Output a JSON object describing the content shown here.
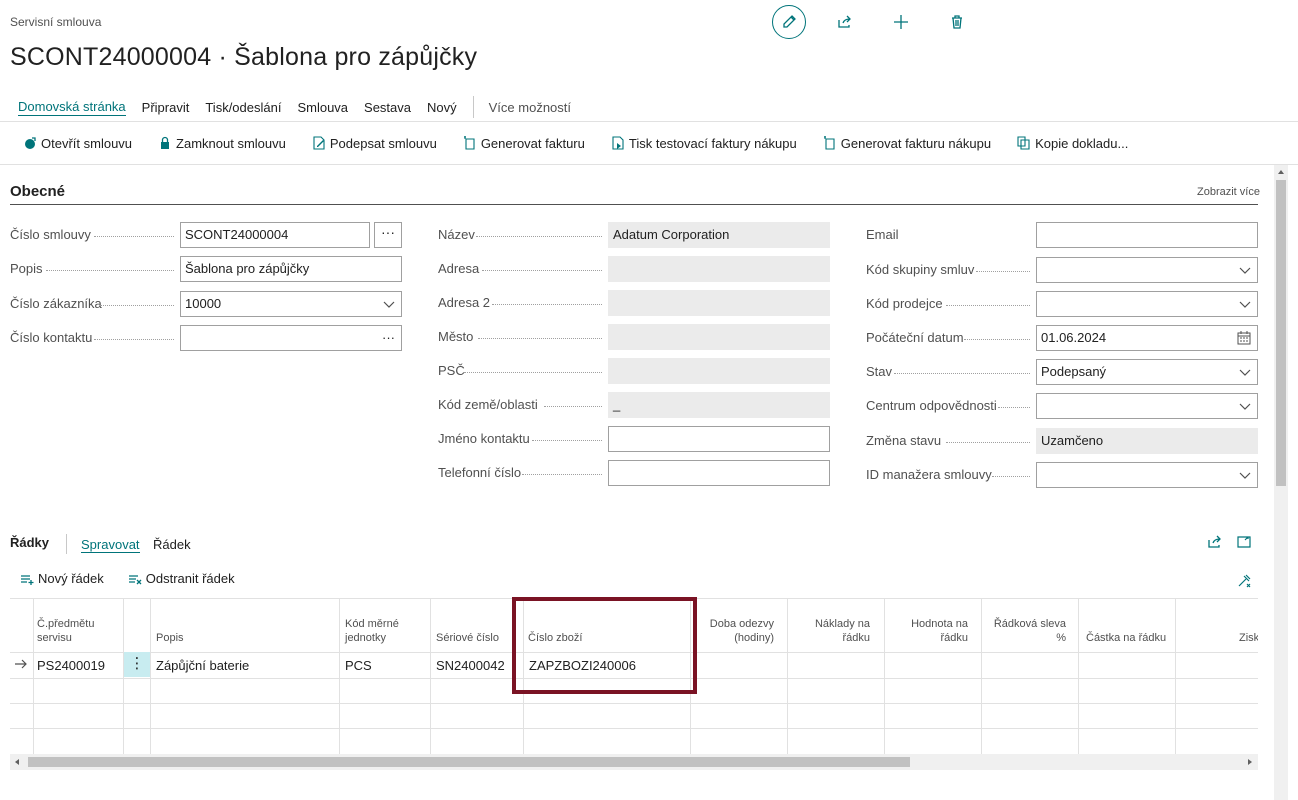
{
  "header": {
    "caption": "Servisní smlouva",
    "title": "SCONT24000004 · Šablona pro zápůjčky"
  },
  "menu": {
    "items": [
      "Domovská stránka",
      "Připravit",
      "Tisk/odeslání",
      "Smlouva",
      "Sestava",
      "Nový"
    ],
    "more": "Více možností"
  },
  "actions": [
    {
      "label": "Otevřít smlouvu",
      "icon": "open-contract-icon"
    },
    {
      "label": "Zamknout smlouvu",
      "icon": "lock-icon"
    },
    {
      "label": "Podepsat smlouvu",
      "icon": "sign-icon"
    },
    {
      "label": "Generovat fakturu",
      "icon": "generate-invoice-icon"
    },
    {
      "label": "Tisk testovací faktury nákupu",
      "icon": "print-document-icon"
    },
    {
      "label": "Generovat fakturu nákupu",
      "icon": "generate-invoice-icon"
    },
    {
      "label": "Kopie dokladu...",
      "icon": "copy-document-icon"
    }
  ],
  "general": {
    "title": "Obecné",
    "show_more": "Zobrazit více",
    "col1": [
      {
        "label": "Číslo smlouvy",
        "value": "SCONT24000004"
      },
      {
        "label": "Popis",
        "value": "Šablona pro zápůjčky"
      },
      {
        "label": "Číslo zákazníka",
        "value": "10000"
      },
      {
        "label": "Číslo kontaktu",
        "value": ""
      }
    ],
    "col2": [
      {
        "label": "Název",
        "value": "Adatum Corporation"
      },
      {
        "label": "Adresa",
        "value": ""
      },
      {
        "label": "Adresa 2",
        "value": ""
      },
      {
        "label": "Město",
        "value": ""
      },
      {
        "label": "PSČ",
        "value": ""
      },
      {
        "label": "Kód země/oblasti",
        "value": "_"
      },
      {
        "label": "Jméno kontaktu",
        "value": ""
      },
      {
        "label": "Telefonní číslo",
        "value": ""
      }
    ],
    "col3": [
      {
        "label": "Email",
        "value": ""
      },
      {
        "label": "Kód skupiny smluv",
        "value": ""
      },
      {
        "label": "Kód prodejce",
        "value": ""
      },
      {
        "label": "Počáteční datum",
        "value": "01.06.2024"
      },
      {
        "label": "Stav",
        "value": "Podepsaný"
      },
      {
        "label": "Centrum odpovědnosti",
        "value": ""
      },
      {
        "label": "Změna stavu",
        "value": "Uzamčeno"
      },
      {
        "label": "ID manažera smlouvy",
        "value": ""
      }
    ],
    "lookup_glyph": "···"
  },
  "lines": {
    "title": "Řádky",
    "tabs": [
      "Spravovat",
      "Řádek"
    ],
    "actions": [
      "Nový řádek",
      "Odstranit řádek"
    ],
    "columns": [
      "Č.předmětu servisu",
      "Popis",
      "Kód měrné jednotky",
      "Sériové číslo",
      "Číslo zboží",
      "Doba odezvy (hodiny)",
      "Náklady na řádku",
      "Hodnota na řádku",
      "Řádková sleva %",
      "Částka na řádku",
      "Zisk"
    ],
    "row": {
      "item_no": "PS2400019",
      "description": "Zápůjční baterie",
      "uom": "PCS",
      "serial": "SN2400042",
      "product_no": "ZAPZBOZI240006"
    },
    "row_menu_glyph": "⋮"
  },
  "colors": {
    "accent": "#00747a",
    "highlight": "#7a1324"
  }
}
